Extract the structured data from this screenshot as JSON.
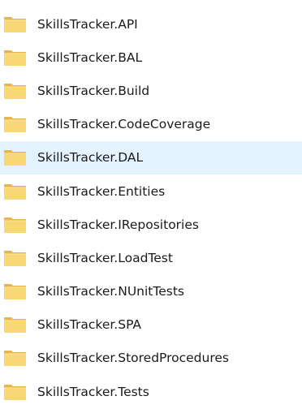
{
  "explorer": {
    "items": [
      {
        "label": "SkillsTracker.API",
        "icon": "folder-icon",
        "selected": false
      },
      {
        "label": "SkillsTracker.BAL",
        "icon": "folder-icon",
        "selected": false
      },
      {
        "label": "SkillsTracker.Build",
        "icon": "folder-icon",
        "selected": false
      },
      {
        "label": "SkillsTracker.CodeCoverage",
        "icon": "folder-icon",
        "selected": false
      },
      {
        "label": "SkillsTracker.DAL",
        "icon": "folder-icon",
        "selected": true
      },
      {
        "label": "SkillsTracker.Entities",
        "icon": "folder-icon",
        "selected": false
      },
      {
        "label": "SkillsTracker.IRepositories",
        "icon": "folder-icon",
        "selected": false
      },
      {
        "label": "SkillsTracker.LoadTest",
        "icon": "folder-icon",
        "selected": false
      },
      {
        "label": "SkillsTracker.NUnitTests",
        "icon": "folder-icon",
        "selected": false
      },
      {
        "label": "SkillsTracker.SPA",
        "icon": "folder-icon",
        "selected": false
      },
      {
        "label": "SkillsTracker.StoredProcedures",
        "icon": "folder-icon",
        "selected": false
      },
      {
        "label": "SkillsTracker.Tests",
        "icon": "folder-icon",
        "selected": false
      }
    ],
    "colors": {
      "folder_back": "#e8b64c",
      "folder_front": "#f8d775",
      "selection_bg": "#e5f3ff",
      "text": "#1a1a1a"
    }
  }
}
